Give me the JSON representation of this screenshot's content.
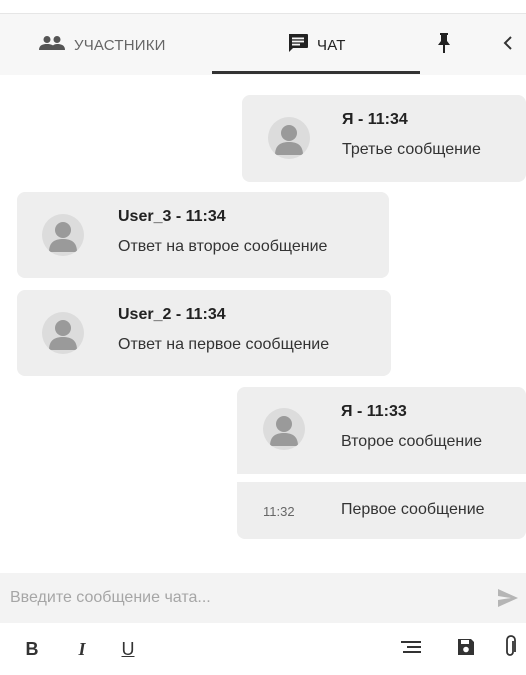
{
  "tabs": {
    "participants_label": "УЧАСТНИКИ",
    "chat_label": "ЧАТ",
    "participants_icon": "people-icon",
    "chat_icon": "chat-icon",
    "pin_icon": "pin-icon",
    "collapse_icon": "chevron-left-icon"
  },
  "messages": [
    {
      "author": "Я - 11:34",
      "text": "Третье сообщение",
      "side": "right"
    },
    {
      "author": "User_3 - 11:34",
      "text": "Ответ на второе сообщение",
      "side": "left"
    },
    {
      "author": "User_2 - 11:34",
      "text": "Ответ на первое сообщение",
      "side": "left"
    },
    {
      "author": "Я - 11:33",
      "text": "Второе сообщение",
      "side": "right"
    },
    {
      "time": "11:32",
      "text": "Первое сообщение",
      "side": "right",
      "grouped": true
    }
  ],
  "composer": {
    "placeholder": "Введите сообщение чата...",
    "send_icon": "send-icon"
  },
  "toolbar": {
    "bold_label": "B",
    "italic_label": "I",
    "underline_label": "U",
    "icons": [
      "bold-icon",
      "italic-icon",
      "underline-icon",
      "format-list-icon",
      "save-icon",
      "attachment-icon"
    ]
  },
  "colors": {
    "bubble": "#eeeeee",
    "topbar": "#f7f7f7",
    "composer": "#f3f3f3",
    "underline": "#333333",
    "avatar": "#dcdcdc"
  }
}
